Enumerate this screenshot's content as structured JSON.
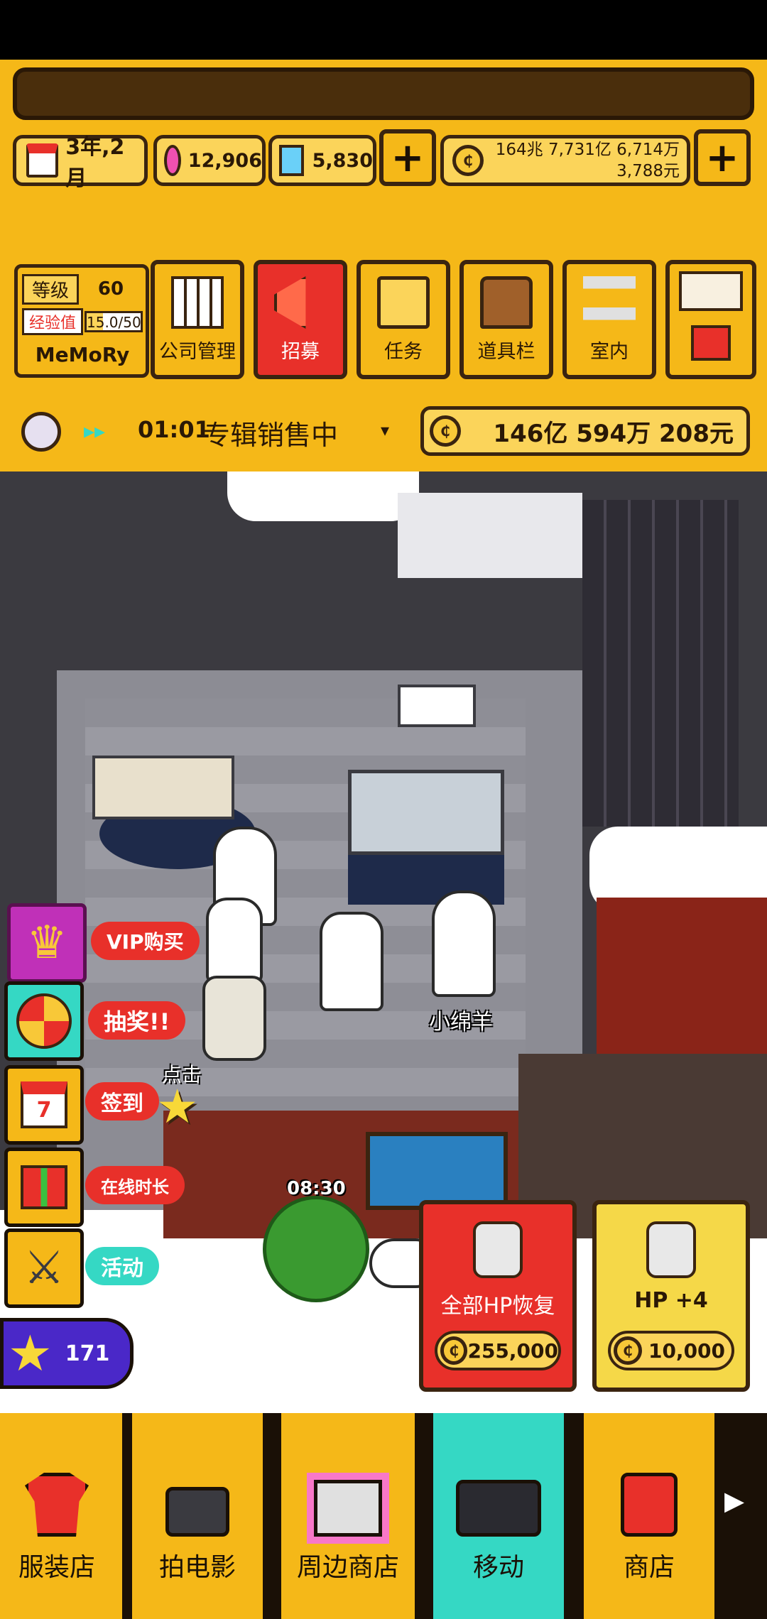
{
  "resources": {
    "date": "3年,2月",
    "gems": "12,906",
    "diamonds": "5,830",
    "money_line1": "164兆 7,731亿 6,714万",
    "money_line2": "3,788元"
  },
  "level": {
    "level_label": "等级",
    "level_value": "60",
    "exp_label": "经验值",
    "exp_value": "15.0/50",
    "exp_progress": 0.3,
    "company_name": "MeMoRy"
  },
  "menu": [
    {
      "label": "公司管理"
    },
    {
      "label": "招募"
    },
    {
      "label": "任务"
    },
    {
      "label": "道具栏"
    },
    {
      "label": "室内"
    }
  ],
  "info_bar": {
    "speed_icon": "fast-forward-icon",
    "time": "01:01",
    "status": "专辑销售中",
    "revenue": "146亿 594万 208元"
  },
  "side_buttons": {
    "vip": "VIP购买",
    "lottery": "抽奖!!",
    "checkin": "签到",
    "online": "在线时长",
    "event": "活动",
    "click_hint": "点击",
    "stars": "171"
  },
  "scene": {
    "character_name": "小绵羊",
    "timer": "08:30"
  },
  "shop_cards": [
    {
      "title": "全部HP恢复",
      "price": "255,000"
    },
    {
      "title": "HP +4",
      "price": "10,000"
    }
  ],
  "bottom_nav": [
    {
      "label": "服装店"
    },
    {
      "label": "拍电影"
    },
    {
      "label": "周边商店"
    },
    {
      "label": "移动"
    },
    {
      "label": "商店"
    }
  ],
  "colors": {
    "hud_yellow": "#f5b818",
    "border_brown": "#3a2410",
    "recruit_red": "#e8302a",
    "active_teal": "#35d8c4"
  }
}
